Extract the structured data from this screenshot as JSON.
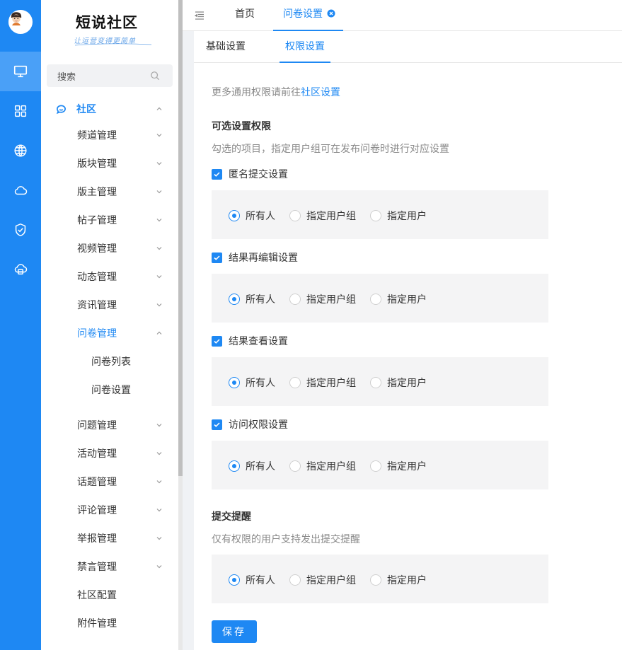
{
  "colors": {
    "primary": "#1e88f3",
    "rail_bg": "#1e88f3",
    "rail_active": "#4aa0f7",
    "panel_bg": "#f4f4f5"
  },
  "rail": {
    "items": [
      {
        "icon": "monitor-icon",
        "active": true
      },
      {
        "icon": "grid-icon"
      },
      {
        "icon": "globe-icon"
      },
      {
        "icon": "cloud-icon"
      },
      {
        "icon": "shield-check-icon"
      },
      {
        "icon": "cloud-storage-icon"
      }
    ]
  },
  "sidebar": {
    "logo_title": "短说社区",
    "logo_sub": "让运营变得更简单",
    "search_placeholder": "搜索",
    "section": "社区",
    "items": [
      "频道管理",
      "版块管理",
      "版主管理",
      "帖子管理",
      "视频管理",
      "动态管理",
      "资讯管理",
      "问卷管理",
      "问卷列表",
      "问卷设置",
      "问题管理",
      "活动管理",
      "话题管理",
      "评论管理",
      "举报管理",
      "禁言管理",
      "社区配置",
      "附件管理"
    ]
  },
  "topbar": {
    "tabs": [
      "首页",
      "问卷设置"
    ]
  },
  "subtabs": [
    "基础设置",
    "权限设置"
  ],
  "content": {
    "hint_prefix": "更多通用权限请前往",
    "hint_link": "社区设置",
    "optional_title": "可选设置权限",
    "optional_desc": "勾选的项目，指定用户组可在发布问卷时进行对应设置",
    "settings": [
      {
        "label": "匿名提交设置",
        "checked": true,
        "selected": "所有人"
      },
      {
        "label": "结果再编辑设置",
        "checked": true,
        "selected": "所有人"
      },
      {
        "label": "结果查看设置",
        "checked": true,
        "selected": "所有人"
      },
      {
        "label": "访问权限设置",
        "checked": true,
        "selected": "所有人"
      }
    ],
    "radio_options": [
      "所有人",
      "指定用户组",
      "指定用户"
    ],
    "remind_title": "提交提醒",
    "remind_desc": "仅有权限的用户支持发出提交提醒",
    "remind_selected": "所有人",
    "save_label": "保存"
  }
}
